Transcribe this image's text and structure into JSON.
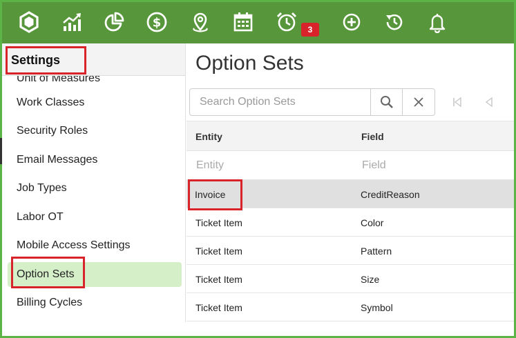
{
  "topbar": {
    "icons": [
      "hexagon-logo-icon",
      "growth-chart-icon",
      "pie-chart-icon",
      "dollar-icon",
      "location-pin-icon",
      "calendar-icon",
      "alarm-clock-icon",
      "plus-circle-icon",
      "history-icon",
      "bell-icon"
    ],
    "alarm_badge": "3"
  },
  "sidebar": {
    "title": "Settings",
    "clipped_item": "Unit of Measures",
    "items": [
      "Work Classes",
      "Security Roles",
      "Email Messages",
      "Job Types",
      "Labor OT",
      "Mobile Access Settings",
      "Option Sets",
      "Billing Cycles"
    ],
    "active_item": "Option Sets"
  },
  "main": {
    "title": "Option Sets",
    "search_placeholder": "Search Option Sets",
    "columns": {
      "entity": "Entity",
      "field": "Field"
    },
    "filter_placeholders": {
      "entity": "Entity",
      "field": "Field"
    },
    "rows": [
      {
        "entity": "Invoice",
        "field": "CreditReason"
      },
      {
        "entity": "Ticket Item",
        "field": "Color"
      },
      {
        "entity": "Ticket Item",
        "field": "Pattern"
      },
      {
        "entity": "Ticket Item",
        "field": "Size"
      },
      {
        "entity": "Ticket Item",
        "field": "Symbol"
      }
    ]
  },
  "colors": {
    "topbar": "#57963a",
    "active_item_bg": "#d5efc9",
    "highlight_box": "#d9232a",
    "badge": "#d9232a"
  }
}
